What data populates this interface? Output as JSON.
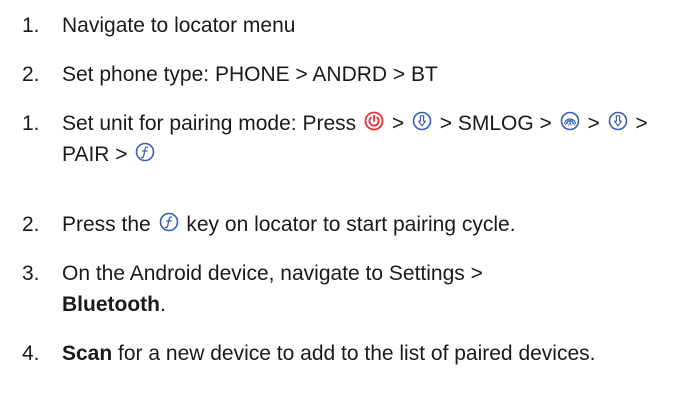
{
  "steps": [
    {
      "number": "1.",
      "parts": [
        "Navigate to locator menu"
      ]
    },
    {
      "number": "2.",
      "parts": [
        "Set phone type: PHONE > ANDRD > BT"
      ]
    },
    {
      "number": "1.",
      "parts": [
        "Set unit for pairing mode: Press ",
        " > ",
        " > SMLOG > ",
        " > ",
        " > PAIR > "
      ]
    },
    {
      "number": "2.",
      "parts": [
        "Press the ",
        " key on locator to start pairing cycle."
      ]
    },
    {
      "number": "3.",
      "parts": [
        "On the Android device, navigate to Settings > ",
        "Bluetooth",
        "."
      ]
    },
    {
      "number": "4.",
      "parts": [
        "Scan",
        " for a new device to add to the list of paired devices."
      ]
    }
  ],
  "icons": {
    "power": "power-icon",
    "down": "down-arrow-icon",
    "mode": "antenna-mode-icon",
    "function": "function-key-icon"
  },
  "colors": {
    "power_red": "#e8303a",
    "key_blue": "#3b5fb0",
    "text": "#1a1a1a"
  }
}
